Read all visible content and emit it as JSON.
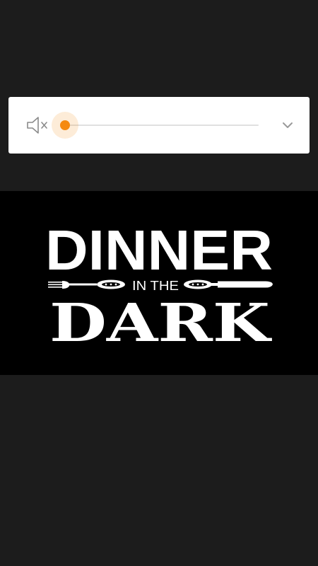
{
  "volume_control": {
    "muted": true,
    "level_percent": 0,
    "accent_color": "#f5890f",
    "mute_icon": "volume-muted-icon",
    "expand_icon": "chevron-down-icon"
  },
  "banner": {
    "line1": "DINNER",
    "line2": "IN THE",
    "line3": "DARK",
    "background_color": "#000000",
    "text_color": "#ffffff",
    "fork_icon": "fork-icon",
    "knife_icon": "knife-icon"
  }
}
